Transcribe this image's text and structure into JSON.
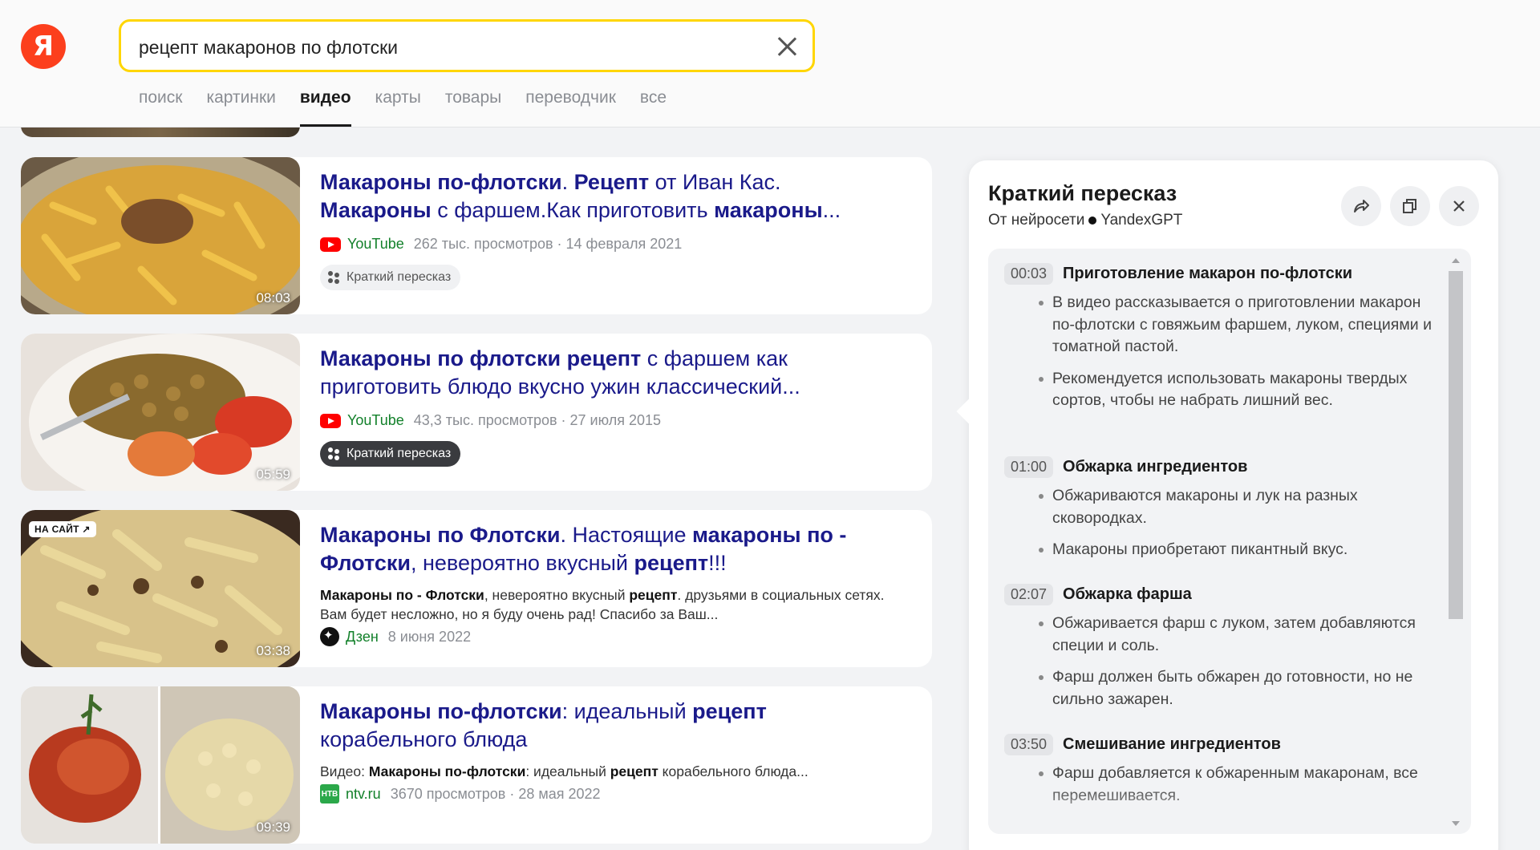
{
  "header": {
    "logo_text": "Я",
    "search_query": "рецепт макаронов по флотски",
    "tabs": [
      {
        "label": "поиск",
        "active": false
      },
      {
        "label": "картинки",
        "active": false
      },
      {
        "label": "видео",
        "active": true
      },
      {
        "label": "карты",
        "active": false
      },
      {
        "label": "товары",
        "active": false
      },
      {
        "label": "переводчик",
        "active": false
      },
      {
        "label": "все",
        "active": false
      }
    ]
  },
  "results": [
    {
      "title_html": "<b>Макароны по-флотски</b>. <b>Рецепт</b> от Иван Кас. <b>Макароны</b> с фаршем.Как приготовить <b>макароны</b>...",
      "duration": "08:03",
      "source": "YouTube",
      "source_icon": "youtube-icon",
      "views_date": "262 тыс. просмотров · 14 февраля 2021",
      "summary_label": "Краткий пересказ",
      "summary_active": false
    },
    {
      "title_html": "<b>Макароны по флотски рецепт</b> с фаршем как приготовить блюдо вкусно ужин классический...",
      "duration": "05:59",
      "source": "YouTube",
      "source_icon": "youtube-icon",
      "views_date": "43,3 тыс. просмотров · 27 июля 2015",
      "summary_label": "Краткий пересказ",
      "summary_active": true
    },
    {
      "title_html": "<b>Макароны по Флотски</b>. Настоящие <b>макароны по - Флотски</b>, невероятно вкусный <b>рецепт</b>!!!",
      "duration": "03:38",
      "site_badge": "НА САЙТ ↗",
      "snippet_html": "<b>Макароны по - Флотски</b>, невероятно вкусный <b>рецепт</b>. друзьями в социальных сетях. Вам будет несложно, но я буду очень рад! Спасибо за Ваш...",
      "source": "Дзен",
      "source_icon": "dzen-icon",
      "views_date": "8 июня 2022"
    },
    {
      "title_html": "<b>Макароны по-флотски</b>: идеальный <b>рецепт</b> корабельного блюда",
      "duration": "09:39",
      "snippet_html": "Видео: <b>Макароны по-флотски</b>: идеальный <b>рецепт</b> корабельного блюда...",
      "source": "ntv.ru",
      "source_icon": "ntv-icon",
      "ntv_icon_text": "НТВ",
      "views_date": "3670 просмотров · 28 мая 2022"
    }
  ],
  "panel": {
    "title": "Краткий пересказ",
    "subtitle_prefix": "От нейросети",
    "subtitle_brand": "YandexGPT",
    "segments": [
      {
        "time": "00:03",
        "title": "Приготовление макарон по-флотски",
        "bullets": [
          "В видео рассказывается о приготовлении макарон по-флотски с говяжьим фаршем, луком, специями и томатной пастой.",
          "Рекомендуется использовать макароны твердых сортов, чтобы не набрать лишний вес."
        ]
      },
      {
        "time": "01:00",
        "title": "Обжарка ингредиентов",
        "bullets": [
          "Обжариваются макароны и лук на разных сковородках.",
          "Макароны приобретают пикантный вкус."
        ]
      },
      {
        "time": "02:07",
        "title": "Обжарка фарша",
        "bullets": [
          "Обжаривается фарш с луком, затем добавляются специи и соль.",
          "Фарш должен быть обжарен до готовности, но не сильно зажарен."
        ]
      },
      {
        "time": "03:50",
        "title": "Смешивание ингредиентов",
        "bullets": [
          "Фарш добавляется к обжаренным макаронам, все перемешивается."
        ]
      }
    ]
  },
  "colors": {
    "accent_yellow": "#ffd600",
    "logo_red": "#fc3f1d",
    "title_link": "#1a1a8a",
    "source_green": "#12802a"
  }
}
